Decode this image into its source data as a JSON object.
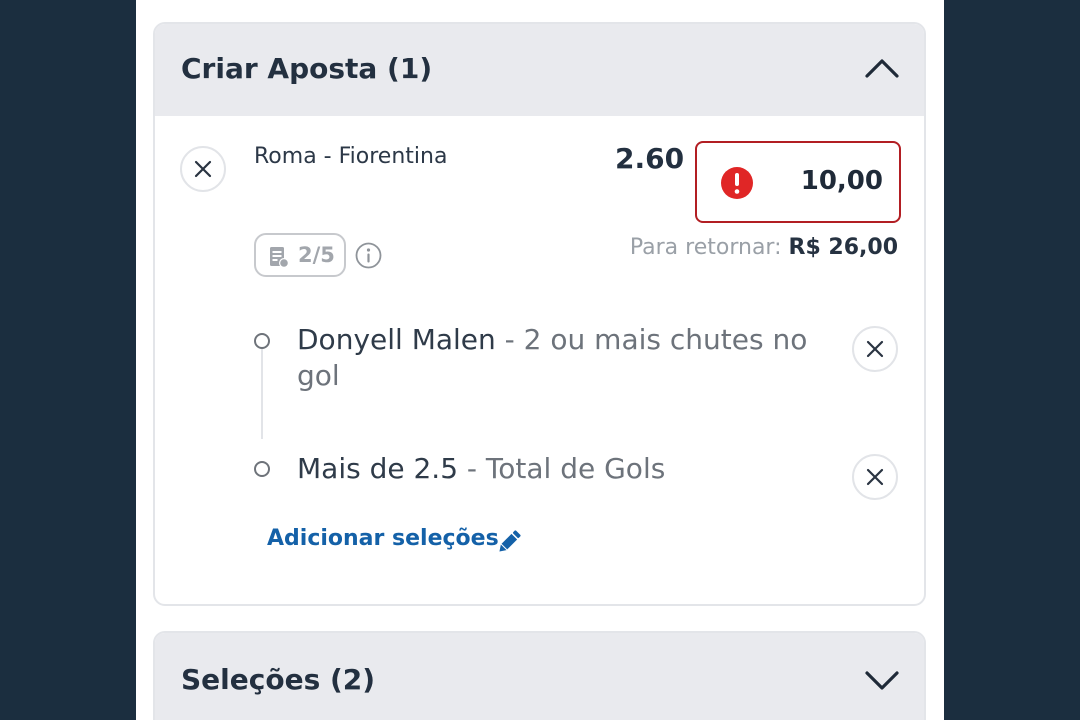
{
  "bet_builder": {
    "title": "Criar Aposta (1)",
    "match": "Roma - Fiorentina",
    "odds": "2.60",
    "stake_value": "10,00",
    "badge": "2/5",
    "return_label": "Para retornar:",
    "return_value": "R$ 26,00",
    "selections": [
      {
        "player": "Donyell Malen",
        "market": " - 2 ou mais chutes no gol"
      },
      {
        "player": "Mais de 2.5",
        "market": " - Total de Gols"
      }
    ],
    "add_selections_label": "Adicionar seleções"
  },
  "selections_panel": {
    "title": "Seleções (2)"
  },
  "colors": {
    "background": "#1b2e3f",
    "header": "#e9eaee",
    "error": "#e02626",
    "link": "#1461a8"
  }
}
